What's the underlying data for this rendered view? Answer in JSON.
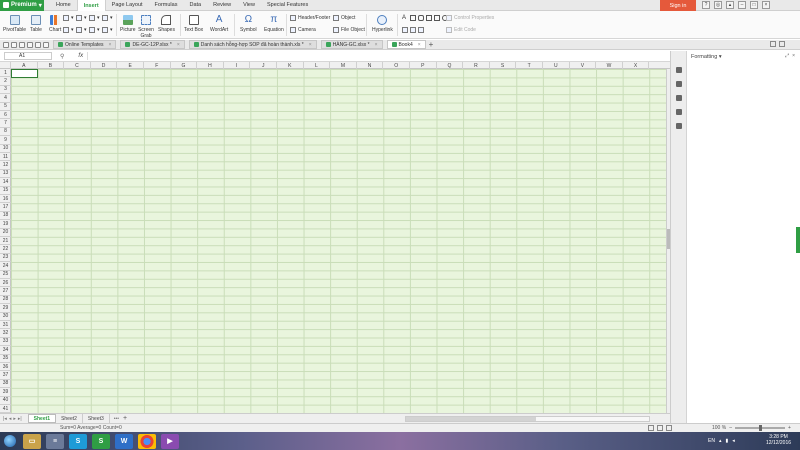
{
  "menubar": {
    "brand": "Premium",
    "items": [
      "Home",
      "Insert",
      "Page Layout",
      "Formulas",
      "Data",
      "Review",
      "View",
      "Special Features"
    ],
    "active_index": 1,
    "sign_in": "Sign in"
  },
  "ribbon": {
    "pivot_table": "PivotTable",
    "table": "Table",
    "chart": "Chart",
    "picture": "Picture",
    "screen_grab": "Screen Grab",
    "shapes": "Shapes",
    "text_box": "Text Box",
    "wordart": "WordArt",
    "symbol": "Symbol",
    "equation": "Equation",
    "header_footer": "Header/Footer",
    "object": "Object",
    "camera": "Camera",
    "file_object": "File Object",
    "hyperlink": "Hyperlink",
    "control_properties": "Control Properties",
    "edit_code": "Edit Code"
  },
  "doctabs": {
    "tabs": [
      {
        "label": "Online Templates"
      },
      {
        "label": "DE-GC-12P.xlsx *"
      },
      {
        "label": "Danh sách hỗng-hợp SOP đã hoàn thành.xls *"
      },
      {
        "label": "HÀNG-GC.xlsx *"
      },
      {
        "label": "Book4"
      }
    ],
    "active_index": 4
  },
  "formulabar": {
    "name_box": "A1",
    "fx": "fx"
  },
  "grid": {
    "columns": [
      "A",
      "B",
      "C",
      "D",
      "E",
      "F",
      "G",
      "H",
      "I",
      "J",
      "K",
      "L",
      "M",
      "N",
      "O",
      "P",
      "Q",
      "R",
      "S",
      "T",
      "U",
      "V",
      "W",
      "X"
    ],
    "rows": [
      "1",
      "2",
      "3",
      "4",
      "5",
      "6",
      "7",
      "8",
      "9",
      "10",
      "11",
      "12",
      "13",
      "14",
      "15",
      "16",
      "17",
      "18",
      "19",
      "20",
      "21",
      "22",
      "23",
      "24",
      "25",
      "26",
      "27",
      "28",
      "29",
      "30",
      "31",
      "32",
      "33",
      "34",
      "35",
      "36",
      "37",
      "38",
      "39",
      "40",
      "41"
    ]
  },
  "sheets": {
    "tabs": [
      "Sheet1",
      "Sheet2",
      "Sheet3"
    ],
    "active_index": 0,
    "more": "•••"
  },
  "status": {
    "text": "Sum=0   Average=0   Count=0",
    "zoom": "100 %"
  },
  "panel": {
    "title": "Formatting ▾"
  },
  "taskbar": {
    "lang": "EN",
    "time": "3:28 PM",
    "date": "12/12/2016"
  },
  "colors": {
    "accent": "#2f9e44",
    "sign_in": "#e5593b",
    "grid_bg": "#e9f5dd"
  }
}
